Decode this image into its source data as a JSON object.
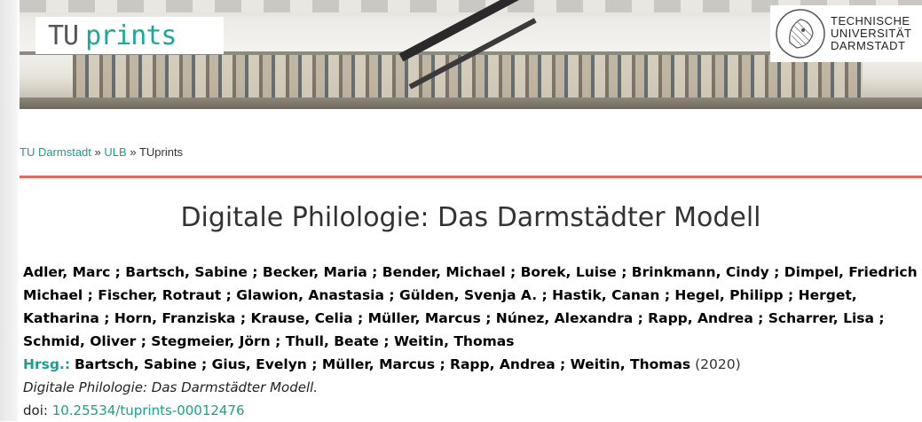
{
  "header": {
    "logo_tu": "TU",
    "logo_prints": "prints",
    "university_lines": [
      "TECHNISCHE",
      "UNIVERSITÄT",
      "DARMSTADT"
    ]
  },
  "breadcrumb": {
    "items": [
      "TU Darmstadt",
      "ULB",
      "TUprints"
    ],
    "separator": "»"
  },
  "record": {
    "title": "Digitale Philologie: Das Darmstädter Modell",
    "authors": "Adler, Marc ; Bartsch, Sabine ; Becker, Maria ; Bender, Michael ; Borek, Luise ; Brinkmann, Cindy ; Dimpel, Friedrich Michael ; Fischer, Rotraut ; Glawion, Anastasia ; Gülden, Svenja A. ; Hastik, Canan ; Hegel, Philipp ; Herget, Katharina ; Horn, Franziska ; Krause, Celia ; Müller, Marcus ; Núnez, Alexandra ; Rapp, Andrea ; Scharrer, Lisa ; Schmid, Oliver ; Stegmeier, Jörn ; Thull, Beate ; Weitin, Thomas",
    "editors_label": "Hrsg.:",
    "editors": "Bartsch, Sabine ; Gius, Evelyn ; Müller, Marcus ; Rapp, Andrea ; Weitin, Thomas",
    "year": "(2020)",
    "publication_title": "Digitale Philologie: Das Darmstädter Modell.",
    "doi_label": "doi:",
    "doi_value": "10.25534/tuprints-00012476"
  },
  "colors": {
    "accent": "#1a9e8f",
    "rule": "#e8665a"
  }
}
